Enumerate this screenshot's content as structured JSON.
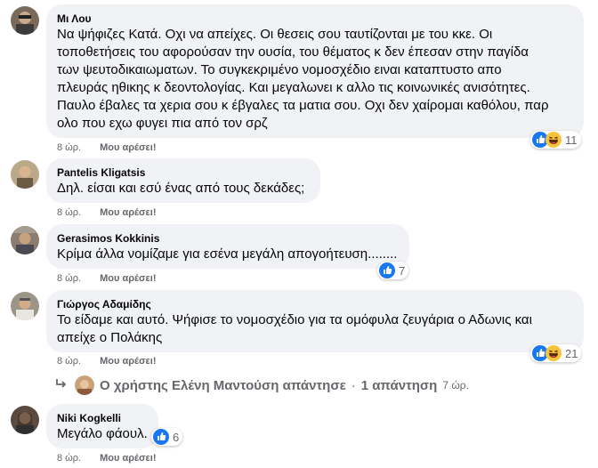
{
  "comments": [
    {
      "author": "Μι Λου",
      "text": "Να ψήφιζες Κατά. Οχι να απείχες. Οι θεσεις σου ταυτίζονται με του κκε. Οι\nτοποθετήσεις του αφορούσαν την ουσία, του θέματος κ δεν έπεσαν στην παγίδα\nτων ψευτοδικαιωματων. Το συγκεκριμένο νομοσχέδιο ειναι καταπτυστο απο\nπλευράς ηθικης κ δεοντολογίας. Και μεγαλωνει κ αλλο τις κοινωνικές ανισότητες.\nΠαυλο έβαλες τα χερια σου κ έβγαλες τα ματια σου. Οχι δεν χαίρομαι καθόλου, παρ\nολο που εχω φυγει πια από τον σρζ",
      "time": "8 ώρ.",
      "like": "Μου αρέσει!",
      "reaction_count": "11",
      "reactions": [
        "like-icon",
        "haha-icon"
      ]
    },
    {
      "author": "Pantelis Kligatsis",
      "text": "Δηλ. είσαι και εσύ ένας από τους δεκάδες;",
      "time": "8 ώρ.",
      "like": "Μου αρέσει!",
      "reaction_count": "",
      "reactions": []
    },
    {
      "author": "Gerasimos Kokkinis",
      "text": "Κρίμα άλλα νομίζαμε για εσένα μεγάλη απογοήτευση........",
      "time": "8 ώρ.",
      "like": "Μου αρέσει!",
      "reaction_count": "7",
      "reactions": [
        "like-icon"
      ]
    },
    {
      "author": "Γιώργος Αδαμίδης",
      "text": "Το είδαμε και αυτό. Ψήφισε το νομοσχέδιο για τα ομόφυλα ζευγάρια ο Αδωνις και\nαπείχε ο Πολάκης",
      "time": "8 ώρ.",
      "like": "Μου αρέσει!",
      "reaction_count": "21",
      "reactions": [
        "like-icon",
        "haha-icon"
      ]
    },
    {
      "author": "Niki Kogkelli",
      "text": "Μεγάλο φάουλ.",
      "time": "8 ώρ.",
      "like": "Μου αρέσει!",
      "reaction_count": "6",
      "reactions": [
        "like-icon"
      ]
    }
  ],
  "reply": {
    "text": "Ο χρήστης Ελένη Μαντούση απάντησε",
    "separator": "·",
    "count": "1 απάντηση",
    "time": "7 ώρ."
  }
}
